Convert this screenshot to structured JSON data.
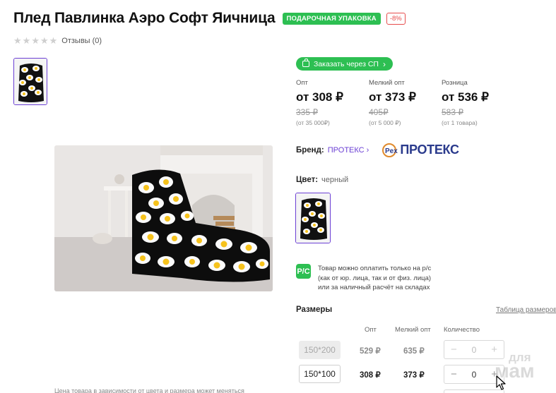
{
  "product": {
    "title": "Плед Павлинка Аэро Софт Яичница",
    "badge_gift": "ПОДАРОЧНАЯ УПАКОВКА",
    "badge_discount": "-8%",
    "rating_stars": 0,
    "reviews_label": "Отзывы (0)"
  },
  "order_button": {
    "label": "Заказать через СП"
  },
  "prices": [
    {
      "label": "Опт",
      "price": "от 308 ₽",
      "old_price": "335 ₽",
      "condition": "(от 35 000₽)"
    },
    {
      "label": "Мелкий опт",
      "price": "от 373 ₽",
      "old_price": "405₽",
      "condition": "(от 5 000 ₽)"
    },
    {
      "label": "Розница",
      "price": "от 536 ₽",
      "old_price": "583 ₽",
      "condition": "(от 1 товара)"
    }
  ],
  "brand": {
    "label": "Бренд:",
    "name": "ПРОТЕКС",
    "logo_text": "ПРОТЕКС"
  },
  "color": {
    "label": "Цвет:",
    "value": "черный"
  },
  "payment": {
    "icon_text": "Р/С",
    "lines": [
      "Товар можно оплатить только на р/с",
      "(как от юр. лица, так и от физ. лица)",
      "или за наличный расчёт на складах"
    ]
  },
  "sizes": {
    "title": "Размеры",
    "chart_link": "Таблица размеров",
    "headers": {
      "opt": "Опт",
      "small_opt": "Мелкий опт",
      "qty": "Количество"
    },
    "rows": [
      {
        "size": "150*200",
        "opt": "529 ₽",
        "small_opt": "635 ₽",
        "qty": "0",
        "available": false
      },
      {
        "size": "150*100",
        "opt": "308 ₽",
        "small_opt": "373 ₽",
        "qty": "0",
        "available": true
      }
    ]
  },
  "price_note": "Цена товара в зависимости от цвета и размера может меняться",
  "watermark": {
    "line1": "для",
    "line2": "мам"
  },
  "colors": {
    "accent_green": "#2dbf52",
    "accent_purple": "#6b3fd4",
    "discount_red": "#e74c4c"
  }
}
